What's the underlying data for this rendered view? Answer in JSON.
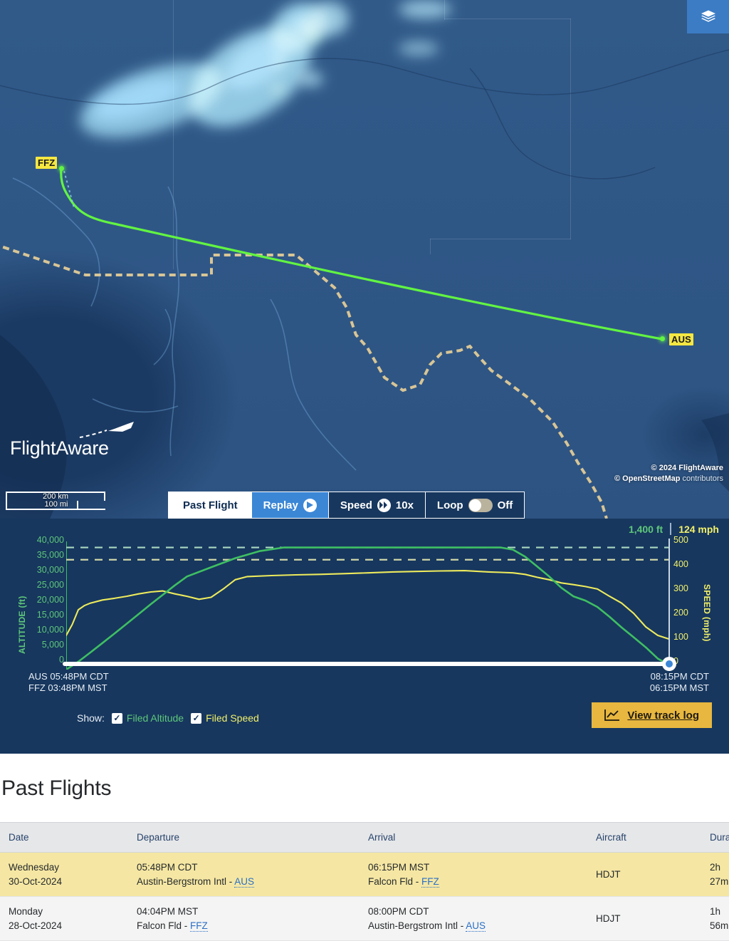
{
  "map": {
    "layers_button": "layers-icon",
    "origin_label": "FFZ",
    "destination_label": "AUS",
    "brand": "FlightAware",
    "scale_km": "200 km",
    "scale_mi": "100 mi",
    "attrib_line1_prefix": "© 2024 ",
    "attrib_line1": "© 2024 FlightAware",
    "attrib_line2": "© OpenStreetMap contributors",
    "attrib_osm": "© OpenStreetMap",
    "attrib_osm_suffix": " contributors",
    "route_color": "#62f442",
    "controls": {
      "past_flight": "Past Flight",
      "replay": "Replay",
      "speed_label": "Speed",
      "speed_value": "10x",
      "loop_label": "Loop",
      "loop_value": "Off"
    }
  },
  "chart": {
    "readout_altitude": "1,400 ft",
    "readout_speed": "124 mph",
    "altitude_axis_title": "ALTITUDE (ft)",
    "speed_axis_title": "SPEED (mph)",
    "departure_line1": "AUS 05:48PM CDT",
    "departure_line2": "FFZ 03:48PM MST",
    "arrival_line1": "08:15PM CDT",
    "arrival_line2": "06:15PM MST",
    "show_label": "Show:",
    "filed_altitude": "Filed Altitude",
    "filed_speed": "Filed Speed",
    "checkmark": "✓",
    "track_log_button": "View track log",
    "altitude_color": "#5ec77a",
    "speed_color": "#f2f06a"
  },
  "chart_data": {
    "type": "line",
    "title": "",
    "xlabel": "",
    "ylabel": "ALTITUDE (ft)",
    "y2label": "SPEED (mph)",
    "grid": false,
    "legend_position": "bottom",
    "x_start_label": "AUS 05:48PM CDT / FFZ 03:48PM MST",
    "x_end_label": "08:15PM CDT / 06:15PM MST",
    "ylim": [
      0,
      42000
    ],
    "y2lim": [
      0,
      525
    ],
    "yticks": [
      0,
      5000,
      10000,
      15000,
      20000,
      25000,
      30000,
      35000,
      40000
    ],
    "ytick_labels": [
      "0",
      "5,000",
      "10,000",
      "15,000",
      "20,000",
      "25,000",
      "30,000",
      "35,000",
      "40,000"
    ],
    "y2ticks": [
      0,
      100,
      200,
      300,
      400,
      500
    ],
    "y2tick_labels": [
      "0",
      "100",
      "200",
      "300",
      "400",
      "500"
    ],
    "reference_lines": [
      {
        "name": "Filed Altitude",
        "value": 40000,
        "color": "#5ec77a",
        "style": "dashed"
      },
      {
        "name": "Filed Speed",
        "value": 450,
        "color": "#f2f06a",
        "style": "dashed"
      }
    ],
    "series": [
      {
        "name": "Altitude",
        "color": "#3fbf63",
        "axis": "left",
        "x": [
          0,
          2,
          4,
          6,
          8,
          10,
          12,
          14,
          16,
          18,
          20,
          24,
          28,
          32,
          36,
          40,
          44,
          48,
          52,
          56,
          60,
          64,
          68,
          70,
          72,
          74,
          76,
          78,
          80,
          82,
          84,
          86,
          88,
          90,
          92,
          94,
          96,
          98,
          100
        ],
        "values": [
          0,
          2600,
          5600,
          8700,
          11800,
          15000,
          18200,
          21400,
          24500,
          27600,
          30500,
          33500,
          36500,
          38800,
          40000,
          40000,
          40000,
          40000,
          40000,
          40000,
          40000,
          40000,
          40000,
          40000,
          40000,
          39300,
          37000,
          33800,
          30500,
          26800,
          24000,
          22600,
          20500,
          17300,
          13800,
          10600,
          7300,
          3600,
          1400
        ]
      },
      {
        "name": "Speed",
        "color": "#edea5c",
        "axis": "right",
        "x": [
          0,
          1,
          2,
          3,
          4,
          6,
          8,
          10,
          12,
          14,
          16,
          18,
          20,
          22,
          24,
          26,
          28,
          30,
          34,
          38,
          42,
          46,
          50,
          54,
          58,
          62,
          66,
          70,
          72,
          74,
          76,
          78,
          80,
          82,
          84,
          86,
          88,
          90,
          92,
          94,
          96,
          98,
          100
        ],
        "values": [
          140,
          185,
          245,
          262,
          272,
          285,
          292,
          300,
          310,
          318,
          322,
          310,
          300,
          288,
          296,
          330,
          368,
          381,
          385,
          388,
          390,
          393,
          396,
          400,
          402,
          404,
          405,
          400,
          398,
          396,
          390,
          378,
          368,
          355,
          348,
          340,
          330,
          300,
          272,
          230,
          175,
          140,
          124
        ]
      }
    ]
  },
  "past_flights": {
    "heading": "Past Flights",
    "columns": [
      "Date",
      "Departure",
      "Arrival",
      "Aircraft",
      "Duration"
    ],
    "rows": [
      {
        "date_day": "Wednesday",
        "date_value": "30-Oct-2024",
        "dep_time": "05:48PM CDT",
        "dep_airport": "Austin-Bergstrom Intl - ",
        "dep_code": "AUS",
        "arr_time": "06:15PM MST",
        "arr_airport": "Falcon Fld - ",
        "arr_code": "FFZ",
        "aircraft": "HDJT",
        "duration": "2h 27m",
        "highlighted": true
      },
      {
        "date_day": "Monday",
        "date_value": "28-Oct-2024",
        "dep_time": "04:04PM MST",
        "dep_airport": "Falcon Fld - ",
        "dep_code": "FFZ",
        "arr_time": "08:00PM CDT",
        "arr_airport": "Austin-Bergstrom Intl - ",
        "arr_code": "AUS",
        "aircraft": "HDJT",
        "duration": "1h 56m",
        "highlighted": false
      }
    ]
  }
}
